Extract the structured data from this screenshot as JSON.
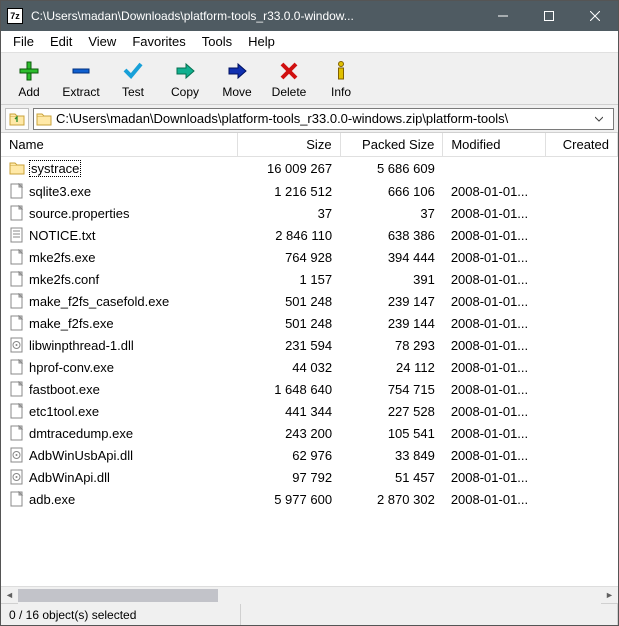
{
  "window": {
    "title": "C:\\Users\\madan\\Downloads\\platform-tools_r33.0.0-window..."
  },
  "menu": {
    "items": [
      "File",
      "Edit",
      "View",
      "Favorites",
      "Tools",
      "Help"
    ]
  },
  "toolbar": {
    "buttons": [
      {
        "id": "add",
        "label": "Add"
      },
      {
        "id": "extract",
        "label": "Extract"
      },
      {
        "id": "test",
        "label": "Test"
      },
      {
        "id": "copy",
        "label": "Copy"
      },
      {
        "id": "move",
        "label": "Move"
      },
      {
        "id": "delete",
        "label": "Delete"
      },
      {
        "id": "info",
        "label": "Info"
      }
    ]
  },
  "address": {
    "path": "C:\\Users\\madan\\Downloads\\platform-tools_r33.0.0-windows.zip\\platform-tools\\"
  },
  "columns": [
    "Name",
    "Size",
    "Packed Size",
    "Modified",
    "Created"
  ],
  "files": [
    {
      "icon": "folder",
      "name": "systrace",
      "size": "16 009 267",
      "packed": "5 686 609",
      "modified": "",
      "selected": true
    },
    {
      "icon": "exe",
      "name": "sqlite3.exe",
      "size": "1 216 512",
      "packed": "666 106",
      "modified": "2008-01-01..."
    },
    {
      "icon": "file",
      "name": "source.properties",
      "size": "37",
      "packed": "37",
      "modified": "2008-01-01..."
    },
    {
      "icon": "txt",
      "name": "NOTICE.txt",
      "size": "2 846 110",
      "packed": "638 386",
      "modified": "2008-01-01..."
    },
    {
      "icon": "exe",
      "name": "mke2fs.exe",
      "size": "764 928",
      "packed": "394 444",
      "modified": "2008-01-01..."
    },
    {
      "icon": "file",
      "name": "mke2fs.conf",
      "size": "1 157",
      "packed": "391",
      "modified": "2008-01-01..."
    },
    {
      "icon": "exe",
      "name": "make_f2fs_casefold.exe",
      "size": "501 248",
      "packed": "239 147",
      "modified": "2008-01-01..."
    },
    {
      "icon": "exe",
      "name": "make_f2fs.exe",
      "size": "501 248",
      "packed": "239 144",
      "modified": "2008-01-01..."
    },
    {
      "icon": "dll",
      "name": "libwinpthread-1.dll",
      "size": "231 594",
      "packed": "78 293",
      "modified": "2008-01-01..."
    },
    {
      "icon": "exe",
      "name": "hprof-conv.exe",
      "size": "44 032",
      "packed": "24 112",
      "modified": "2008-01-01..."
    },
    {
      "icon": "exe",
      "name": "fastboot.exe",
      "size": "1 648 640",
      "packed": "754 715",
      "modified": "2008-01-01..."
    },
    {
      "icon": "exe",
      "name": "etc1tool.exe",
      "size": "441 344",
      "packed": "227 528",
      "modified": "2008-01-01..."
    },
    {
      "icon": "exe",
      "name": "dmtracedump.exe",
      "size": "243 200",
      "packed": "105 541",
      "modified": "2008-01-01..."
    },
    {
      "icon": "dll",
      "name": "AdbWinUsbApi.dll",
      "size": "62 976",
      "packed": "33 849",
      "modified": "2008-01-01..."
    },
    {
      "icon": "dll",
      "name": "AdbWinApi.dll",
      "size": "97 792",
      "packed": "51 457",
      "modified": "2008-01-01..."
    },
    {
      "icon": "exe",
      "name": "adb.exe",
      "size": "5 977 600",
      "packed": "2 870 302",
      "modified": "2008-01-01..."
    }
  ],
  "status": {
    "selection": "0 / 16 object(s) selected"
  }
}
